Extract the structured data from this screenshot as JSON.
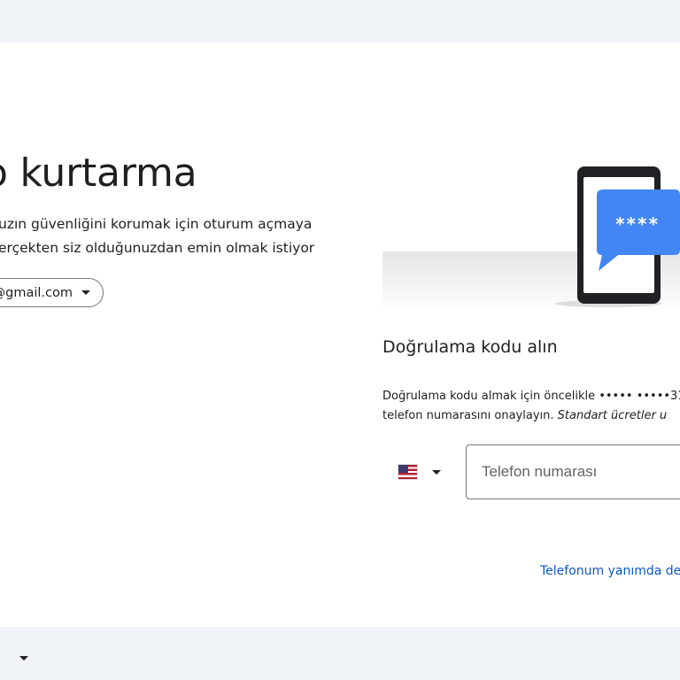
{
  "header": {
    "title": "o kurtarma"
  },
  "description": {
    "line1": "uzın güvenliğini korumak için oturum açmaya",
    "line2": "erçekten siz olduğunuzdan emin olmak istiyor"
  },
  "account": {
    "email": "@gmail.com",
    "icon": "chevron-down-icon"
  },
  "illustration": {
    "bubble_text": "****",
    "icon": "phone-message-illustration"
  },
  "verification": {
    "title": "Doğrulama kodu alın",
    "info_line1": "Doğrulama kodu almak için öncelikle ••••• •••••31",
    "info_line2": "telefon numarasını onaylayın.",
    "info_italic": "Standart ücretler u"
  },
  "phone": {
    "country_flag": "us-flag-icon",
    "placeholder": "Telefon numarası"
  },
  "links": {
    "alternative": "Telefonum yanımda de"
  },
  "colors": {
    "accent": "#0b57d0",
    "bubble": "#1a73e8",
    "background": "#eff2f7"
  }
}
